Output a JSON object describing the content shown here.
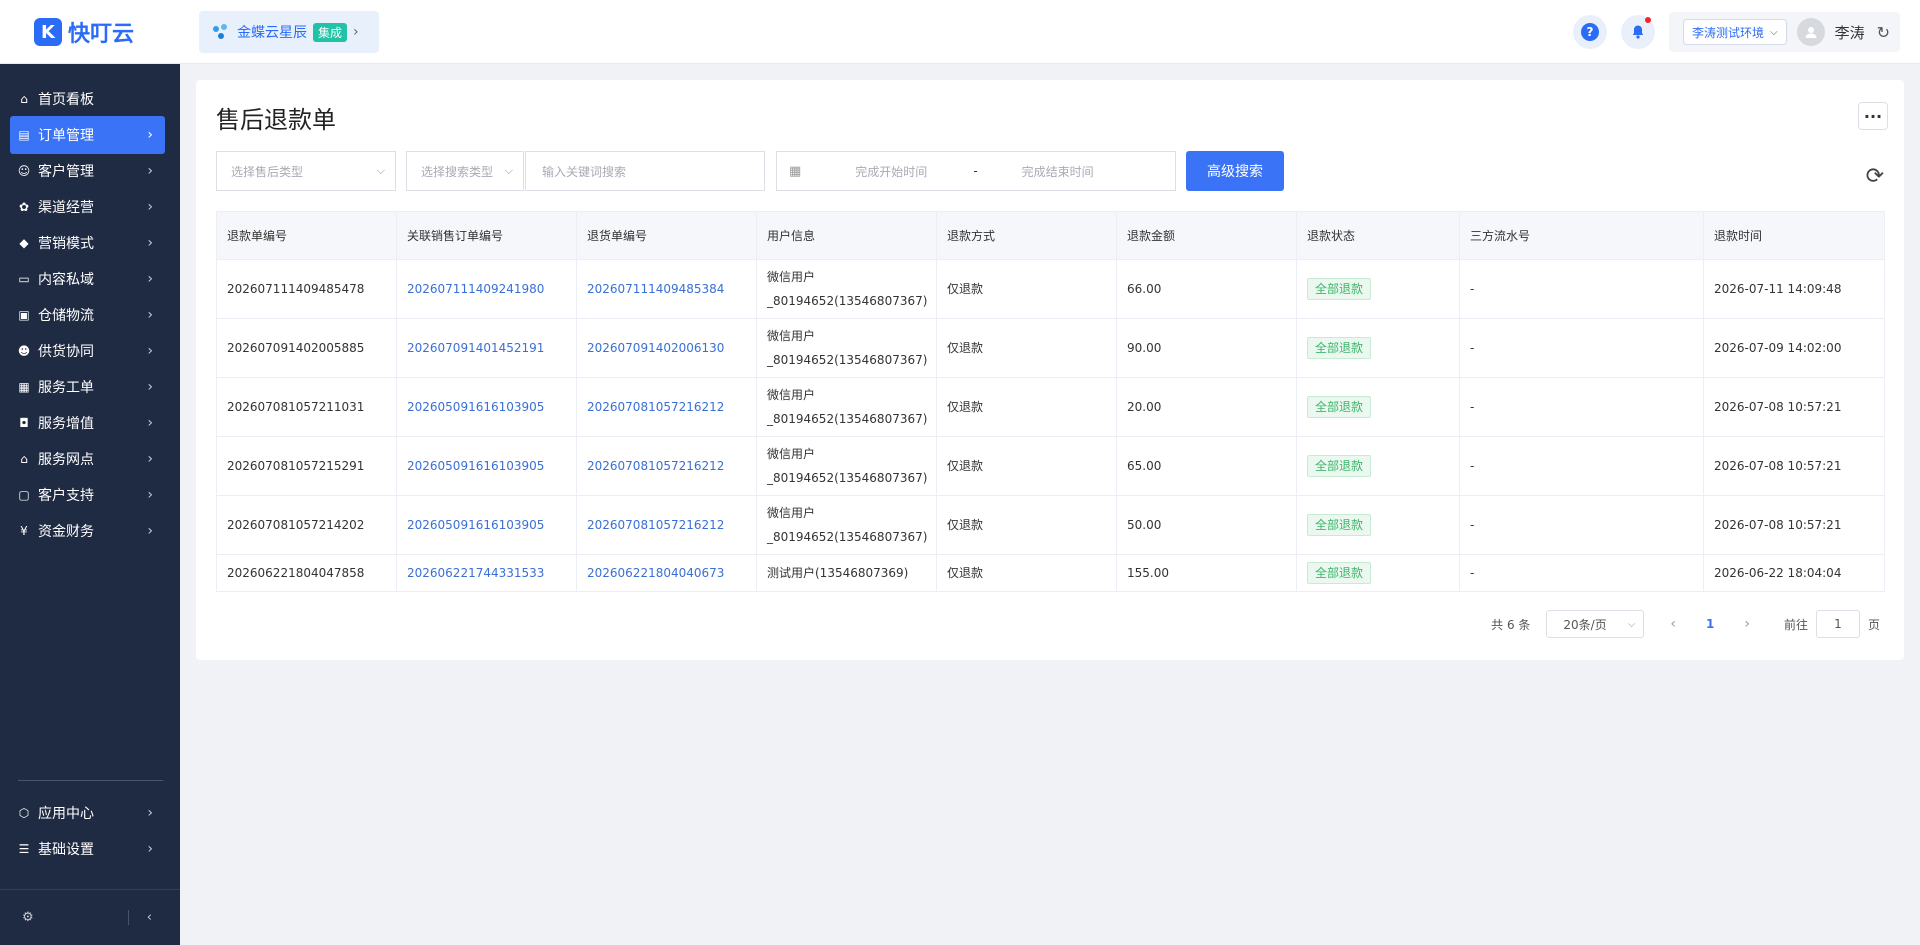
{
  "brand": {
    "name": "快叮云",
    "logo_letter": "K"
  },
  "integration": {
    "name": "金蝶云星辰",
    "tag": "集成"
  },
  "header": {
    "env": "李涛测试环境",
    "user": "李涛"
  },
  "sidebar": {
    "items": [
      {
        "label": "首页看板",
        "icon": "home-icon"
      },
      {
        "label": "订单管理",
        "icon": "order-icon"
      },
      {
        "label": "客户管理",
        "icon": "user-icon"
      },
      {
        "label": "渠道经营",
        "icon": "channel-icon"
      },
      {
        "label": "营销模式",
        "icon": "tag-icon"
      },
      {
        "label": "内容私域",
        "icon": "image-icon"
      },
      {
        "label": "仓储物流",
        "icon": "box-icon"
      },
      {
        "label": "供货协同",
        "icon": "supply-icon"
      },
      {
        "label": "服务工单",
        "icon": "ticket-icon"
      },
      {
        "label": "服务增值",
        "icon": "bag-icon"
      },
      {
        "label": "服务网点",
        "icon": "shop-icon"
      },
      {
        "label": "客户支持",
        "icon": "support-icon"
      },
      {
        "label": "资金财务",
        "icon": "yen-icon"
      }
    ],
    "bottom_items": [
      {
        "label": "应用中心",
        "icon": "cube-icon"
      },
      {
        "label": "基础设置",
        "icon": "settings-icon"
      }
    ]
  },
  "page": {
    "title": "售后退款单",
    "filters": {
      "type_placeholder": "选择售后类型",
      "search_type_placeholder": "选择搜索类型",
      "keyword_placeholder": "输入关键词搜索",
      "start_placeholder": "完成开始时间",
      "separator": "-",
      "end_placeholder": "完成结束时间",
      "search_button": "高级搜索"
    },
    "table": {
      "headers": [
        "退款单编号",
        "关联销售订单编号",
        "退货单编号",
        "用户信息",
        "退款方式",
        "退款金额",
        "退款状态",
        "三方流水号",
        "退款时间"
      ],
      "rows": [
        {
          "refund_no": "202607111409485478",
          "order_no": "202607111409241980",
          "return_no": "202607111409485384",
          "user": "微信用户_80194652(13546807367)",
          "method": "仅退款",
          "amount": "66.00",
          "status": "全部退款",
          "flow": "-",
          "time": "2026-07-11 14:09:48"
        },
        {
          "refund_no": "202607091402005885",
          "order_no": "202607091401452191",
          "return_no": "202607091402006130",
          "user": "微信用户_80194652(13546807367)",
          "method": "仅退款",
          "amount": "90.00",
          "status": "全部退款",
          "flow": "-",
          "time": "2026-07-09 14:02:00"
        },
        {
          "refund_no": "202607081057211031",
          "order_no": "202605091616103905",
          "return_no": "202607081057216212",
          "user": "微信用户_80194652(13546807367)",
          "method": "仅退款",
          "amount": "20.00",
          "status": "全部退款",
          "flow": "-",
          "time": "2026-07-08 10:57:21"
        },
        {
          "refund_no": "202607081057215291",
          "order_no": "202605091616103905",
          "return_no": "202607081057216212",
          "user": "微信用户_80194652(13546807367)",
          "method": "仅退款",
          "amount": "65.00",
          "status": "全部退款",
          "flow": "-",
          "time": "2026-07-08 10:57:21"
        },
        {
          "refund_no": "202607081057214202",
          "order_no": "202605091616103905",
          "return_no": "202607081057216212",
          "user": "微信用户_80194652(13546807367)",
          "method": "仅退款",
          "amount": "50.00",
          "status": "全部退款",
          "flow": "-",
          "time": "2026-07-08 10:57:21"
        },
        {
          "refund_no": "202606221804047858",
          "order_no": "202606221744331533",
          "return_no": "202606221804040673",
          "user": "测试用户(13546807369)",
          "method": "仅退款",
          "amount": "155.00",
          "status": "全部退款",
          "flow": "-",
          "time": "2026-06-22 18:04:04"
        }
      ]
    },
    "pagination": {
      "total": "共 6 条",
      "page_size": "20条/页",
      "current": "1",
      "goto_label": "前往",
      "goto_value": "1",
      "page_unit": "页"
    }
  },
  "colors": {
    "sidebar_bg": "#1f2a43",
    "accent": "#3a73f5",
    "link": "#3a6fd6",
    "success": "#3fb56b"
  }
}
